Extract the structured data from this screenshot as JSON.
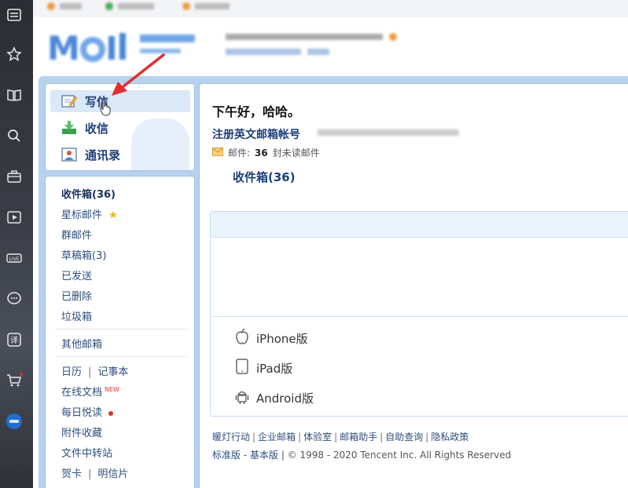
{
  "compose_box": {
    "write_label": "写信",
    "receive_label": "收信",
    "contacts_label": "通讯录"
  },
  "folders": {
    "inbox": "收件箱(36)",
    "starred": "星标邮件",
    "group": "群邮件",
    "drafts": "草稿箱(3)",
    "sent": "已发送",
    "deleted": "已删除",
    "spam": "垃圾箱",
    "other_mailboxes": "其他邮箱",
    "calendar": "日历",
    "notes": "记事本",
    "online_docs": "在线文档",
    "new_badge": "NEW",
    "daily_reading": "每日悦读",
    "attachments": "附件收藏",
    "file_transfer": "文件中转站",
    "greeting_cards": "贺卡",
    "postcards": "明信片"
  },
  "content": {
    "greeting": "下午好，哈哈。",
    "register_english": "注册英文邮箱帐号",
    "mail_label": "邮件:",
    "unread_count": "36",
    "unread_suffix": "封未读邮件",
    "inbox_link": "收件箱(36)"
  },
  "apps": {
    "iphone": "iPhone版",
    "ipad": "iPad版",
    "android": "Android版"
  },
  "footer": {
    "links": [
      "暖灯行动",
      "企业邮箱",
      "体验室",
      "邮箱助手",
      "自助查询",
      "隐私政策"
    ],
    "standard": "标准版",
    "basic": "基本版",
    "copyright": "© 1998 - 2020 Tencent Inc. All Rights Reserved"
  },
  "colors": {
    "frame_blue": "#b7d2ee",
    "link_blue": "#1d3f7a",
    "annotation_red": "#e03030"
  },
  "icons": {
    "compose": "pencil-paper-icon",
    "receive": "download-arrow-icon",
    "contacts": "contact-card-icon",
    "apple": "apple-icon",
    "ipad": "tablet-icon",
    "android": "android-icon"
  }
}
